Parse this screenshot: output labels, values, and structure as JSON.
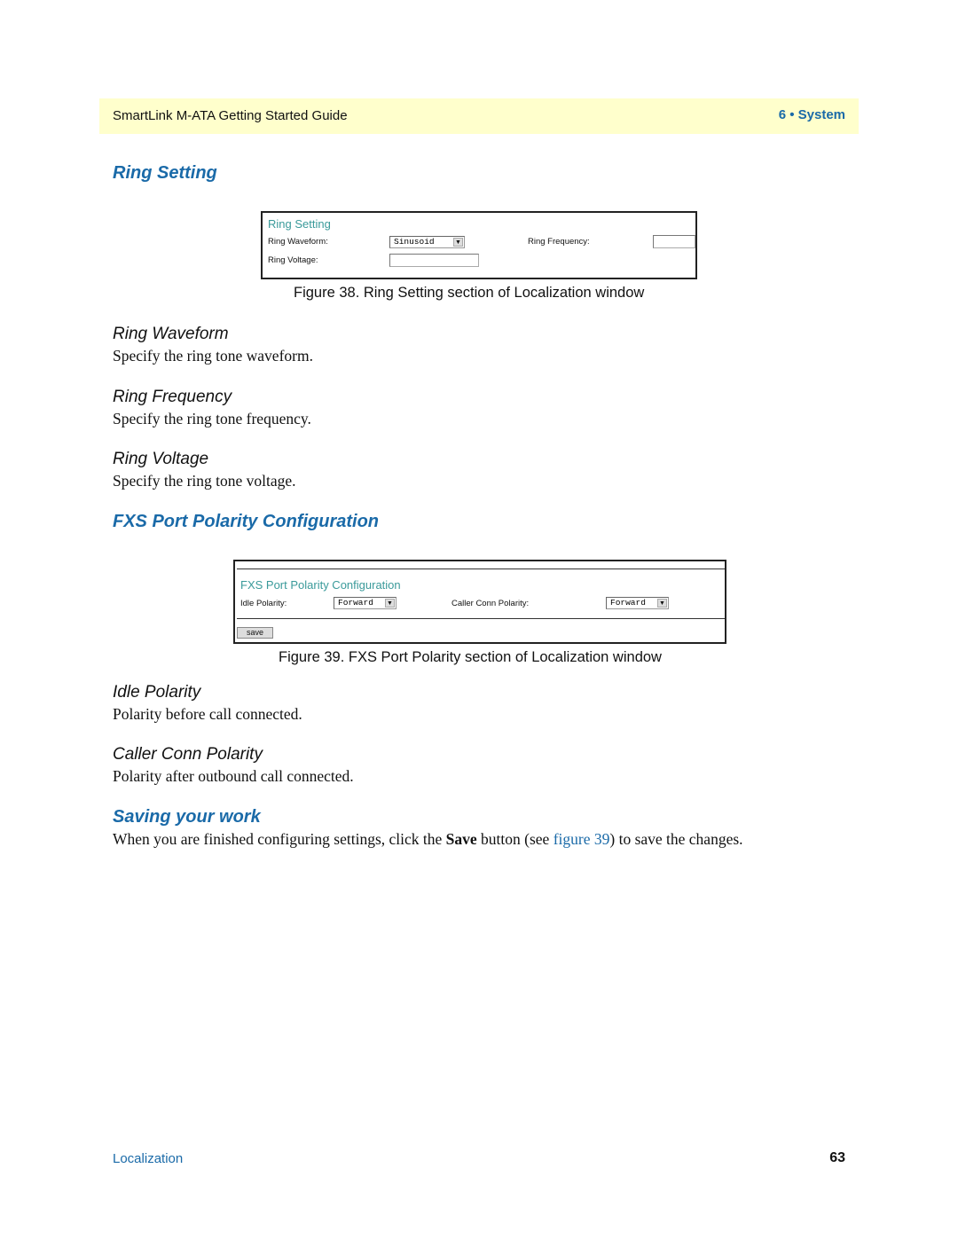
{
  "header": {
    "title": "SmartLink M-ATA Getting Started Guide",
    "chapter": "6 • System"
  },
  "ring_setting": {
    "heading": "Ring Setting",
    "figure": {
      "title": "Ring Setting",
      "waveform_label": "Ring Waveform:",
      "waveform_value": "Sinusoid",
      "frequency_label": "Ring Frequency:",
      "frequency_value": "",
      "voltage_label": "Ring Voltage:",
      "voltage_value": "",
      "dropdown_arrow": "▼"
    },
    "caption": "Figure 38. Ring Setting section of Localization window",
    "items": [
      {
        "title": "Ring Waveform",
        "text": "Specify the ring tone waveform."
      },
      {
        "title": "Ring Frequency",
        "text": "Specify the ring tone frequency."
      },
      {
        "title": "Ring Voltage",
        "text": "Specify the ring tone voltage."
      }
    ]
  },
  "fxs_polarity": {
    "heading": "FXS Port Polarity Configuration",
    "figure": {
      "title": "FXS Port Polarity Configuration",
      "idle_label": "Idle Polarity:",
      "idle_value": "Forward",
      "caller_label": "Caller Conn Polarity:",
      "caller_value": "Forward",
      "save_label": "save",
      "dropdown_arrow": "▼"
    },
    "caption": "Figure 39. FXS Port Polarity section of Localization window",
    "items": [
      {
        "title": "Idle Polarity",
        "text": "Polarity before call connected."
      },
      {
        "title": "Caller Conn Polarity",
        "text": "Polarity after outbound call connected."
      }
    ]
  },
  "saving": {
    "heading": "Saving your work",
    "text_before": "When you are finished configuring settings, click the ",
    "bold": "Save",
    "text_middle": " button (see ",
    "link": "figure 39",
    "text_after": ") to save the changes."
  },
  "footer": {
    "section": "Localization",
    "page_number": "63"
  }
}
